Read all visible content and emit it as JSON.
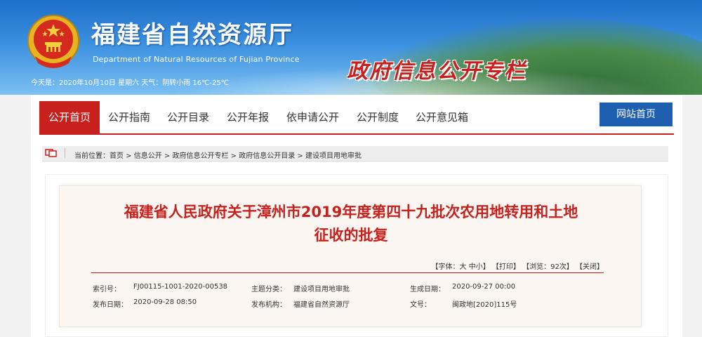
{
  "header": {
    "site_title_cn": "福建省自然资源厅",
    "site_title_en": "Department of Natural Resources of Fujian Province",
    "weather": "今天是：2020年10月10日  星期六 天气：阴转小雨 16℃-25℃",
    "column_title": "政府信息公开专栏"
  },
  "nav": {
    "items": [
      {
        "label": "公开首页"
      },
      {
        "label": "公开指南"
      },
      {
        "label": "公开目录"
      },
      {
        "label": "公开年报"
      },
      {
        "label": "依申请公开"
      },
      {
        "label": "公开制度"
      },
      {
        "label": "公开意见箱"
      }
    ],
    "home_button": "网站首页"
  },
  "breadcrumb": {
    "prefix": "当前位置：",
    "items": [
      "首页",
      "信息公开",
      "政府信息公开专栏",
      "政府信息公开目录",
      "建设项目用地审批"
    ],
    "separator": " > "
  },
  "article": {
    "title_line1": "福建省人民政府关于漳州市2019年度第四十九批次农用地转用和土地",
    "title_line2": "征收的批复",
    "tools": {
      "font_prefix": "【字体：",
      "font_large": "大",
      "font_medium": "中",
      "font_small": "小",
      "font_suffix": "】",
      "print": "【打印】",
      "views": "【浏览：92次】",
      "close": "【关闭】"
    },
    "meta": {
      "index_label": "索引号：",
      "index_value": "FJ00115-1001-2020-00538",
      "topic_label": "主题分类：",
      "topic_value": "建设项目用地审批",
      "created_label": "生成日期：",
      "created_value": "2020-09-27 00:00",
      "published_label": "发布日期：",
      "published_value": "2020-09-28 08:50",
      "agency_label": "发布机构：",
      "agency_value": "福建省自然资源厅",
      "docno_label": "文号：",
      "docno_value": "闽政地[2020]115号"
    }
  },
  "colors": {
    "accent_red": "#c8201c",
    "nav_blue": "#1f5fb0",
    "banner_blue": "#1e6fc8"
  }
}
